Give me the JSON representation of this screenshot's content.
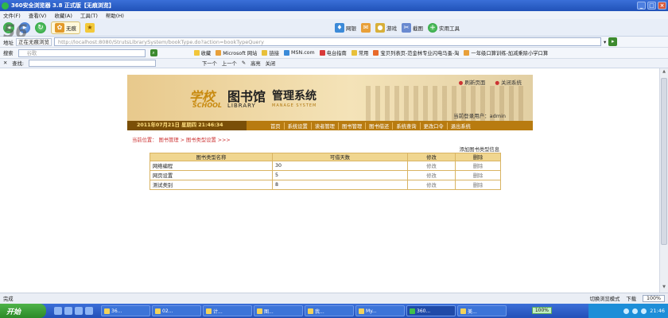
{
  "browser": {
    "title": "360安全浏览器 3.8 正式版【无痕浏览】",
    "menu": [
      "文件(F)",
      "查看(V)",
      "收藏(A)",
      "工具(T)",
      "帮助(H)"
    ],
    "nav": {
      "back_label": "",
      "refresh_label": "",
      "trace_label": "无痕",
      "favorite_label": "",
      "netbank": "网银",
      "games": "游戏",
      "screenshot": "截图",
      "tools": "实用工具"
    },
    "address": {
      "tag": "正在无痕浏览",
      "url": "http://localhost:8080/StrutsLibrarySystem/bookType.do?action=bookTypeQuery",
      "go": "▸"
    },
    "search_label": "搜索",
    "search_placeholder": "谷歌",
    "favorites": [
      "收藏",
      "Microsoft 网站",
      "链接",
      "MSN.com",
      "电台指南",
      "常用",
      "宝贝列表页-范金林专业闪电马蚤-淘",
      "一年级口算训练-加减乘除小学口算"
    ],
    "find": {
      "label": "查找:",
      "next": "下一个",
      "prev": "上一个",
      "highlight": "高亮",
      "close": "关闭"
    },
    "status": {
      "left": "完成",
      "mode": "切换浏览模式",
      "download": "下载",
      "zoom": "100%"
    }
  },
  "app": {
    "header": {
      "school_zh": "学校",
      "school_en": "SCHOOL",
      "library_zh": "图书馆",
      "library_en": "LIBRARY",
      "manage_zh": "管理系统",
      "manage_en": "MANAGE SYSTEM",
      "refresh": "刷新页面",
      "close": "关闭系统",
      "user": "当前登录用户：admin"
    },
    "nav": {
      "datetime": "2011年07月21日 星期四 21:46:34",
      "links": [
        "首页",
        "系统设置",
        "读者管理",
        "图书管理",
        "图书借还",
        "系统查询",
        "更改口令",
        "退出系统"
      ]
    },
    "breadcrumb": {
      "prefix": "当前位置：",
      "level1": "图书管理",
      "sep": ">",
      "level2": "图书类型设置",
      "tail": ">>>"
    },
    "add_link": "添加图书类型信息",
    "table": {
      "headers": [
        "图书类型名称",
        "可借天数",
        "修改",
        "删除"
      ],
      "rows": [
        {
          "name": "网络编程",
          "days": "30",
          "edit": "修改",
          "del": "删除"
        },
        {
          "name": "网页设置",
          "days": "5",
          "edit": "修改",
          "del": "删除"
        },
        {
          "name": "测试类别",
          "days": "8",
          "edit": "修改",
          "del": "删除"
        }
      ]
    }
  },
  "taskbar": {
    "start": "开始",
    "tasks": [
      "36...",
      "02...",
      "计...",
      "图...",
      "我...",
      "My...",
      "360...",
      "美..."
    ],
    "clock": "21:46",
    "percent": "100%"
  },
  "colors": {
    "accent": "#b87b10",
    "header_bg": "#f4e3b8",
    "table_head": "#f0d690",
    "link_red": "#cc3333"
  }
}
